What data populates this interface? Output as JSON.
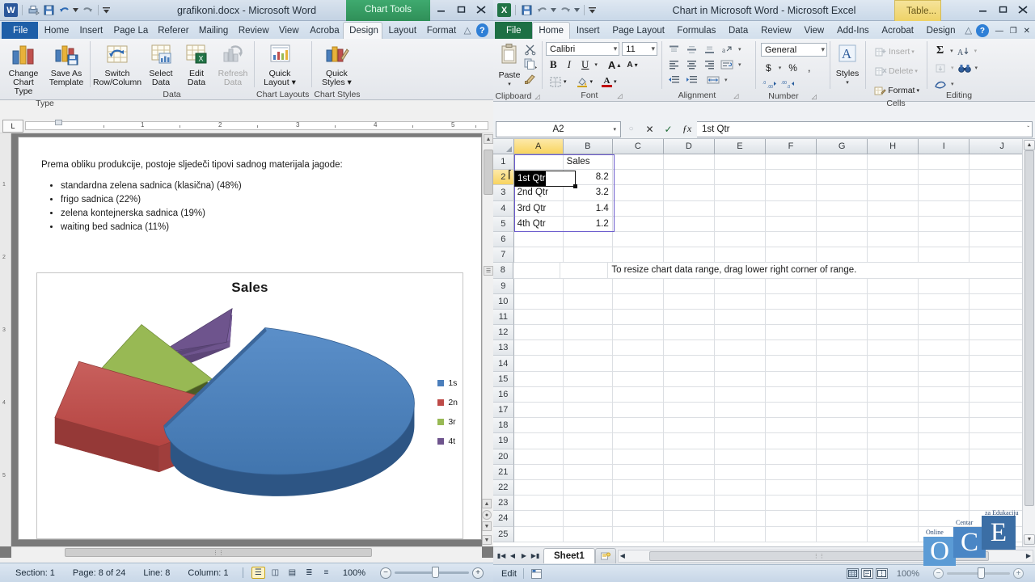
{
  "word": {
    "app_initial": "W",
    "title": "grafikoni.docx  -  Microsoft Word",
    "contextual_tab_label": "Chart Tools",
    "qat": [
      {
        "name": "print-preview-icon",
        "glyph": "⎙"
      },
      {
        "name": "save-icon",
        "glyph": "■"
      },
      {
        "name": "undo-icon",
        "glyph": "↶"
      },
      {
        "name": "undo-dropdown-icon",
        "glyph": "▾"
      },
      {
        "name": "redo-icon",
        "glyph": "↻"
      },
      {
        "name": "customize-qat-icon",
        "glyph": "☰"
      }
    ],
    "window_buttons": {
      "minimize": "—",
      "restore": "❐",
      "close": "✕"
    },
    "tabs": [
      {
        "label": "File",
        "kind": "file"
      },
      {
        "label": "Home"
      },
      {
        "label": "Insert"
      },
      {
        "label": "Page La"
      },
      {
        "label": "Referer"
      },
      {
        "label": "Mailing"
      },
      {
        "label": "Review"
      },
      {
        "label": "View"
      },
      {
        "label": "Acroba"
      },
      {
        "label": "Design",
        "active": true
      },
      {
        "label": "Layout"
      },
      {
        "label": "Format"
      }
    ],
    "tab_right_icons": [
      {
        "name": "minimize-ribbon-icon",
        "glyph": "△"
      },
      {
        "name": "help-icon",
        "glyph": "?"
      }
    ],
    "ribbon_groups": [
      {
        "label": "Type",
        "buttons": [
          {
            "name": "change-chart-type-button",
            "line1": "Change",
            "line2": "Chart Type",
            "icon": "bar-chart-icon"
          },
          {
            "name": "save-as-template-button",
            "line1": "Save As",
            "line2": "Template",
            "icon": "save-template-icon"
          }
        ]
      },
      {
        "label": "Data",
        "buttons": [
          {
            "name": "switch-row-column-button",
            "line1": "Switch",
            "line2": "Row/Column",
            "icon": "switch-rowcol-icon"
          },
          {
            "name": "select-data-button",
            "line1": "Select",
            "line2": "Data",
            "icon": "select-data-icon"
          },
          {
            "name": "edit-data-button",
            "line1": "Edit",
            "line2": "Data",
            "icon": "edit-data-icon"
          },
          {
            "name": "refresh-data-button",
            "line1": "Refresh",
            "line2": "Data",
            "icon": "refresh-data-icon",
            "disabled": true
          }
        ]
      },
      {
        "label": "Chart Layouts",
        "buttons": [
          {
            "name": "quick-layout-button",
            "line1": "Quick",
            "line2": "Layout ▾",
            "icon": "quick-layout-icon"
          }
        ]
      },
      {
        "label": "Chart Styles",
        "buttons": [
          {
            "name": "quick-styles-button",
            "line1": "Quick",
            "line2": "Styles ▾",
            "icon": "quick-styles-icon"
          }
        ]
      }
    ],
    "ruler": {
      "tick_numbers": [
        "1",
        "2",
        "3",
        "4",
        "5"
      ],
      "corner_glyph": "L"
    },
    "document": {
      "intro": "Prema obliku produkcije, postoje sljedeči tipovi sadnog materijala jagode:",
      "bullets": [
        "standardna zelena sadnica (klasična) (48%)",
        "frigo sadnica (22%)",
        "zelena kontejnerska sadnica  (19%)",
        "waiting bed sadnica  (11%)"
      ]
    },
    "status": {
      "section": "Section: 1",
      "page": "Page: 8 of 24",
      "line": "Line: 8",
      "column": "Column: 1",
      "zoom": "100%",
      "view_buttons": [
        {
          "name": "print-layout-view-button",
          "glyph": "☰",
          "active": true
        },
        {
          "name": "full-screen-reading-view-button",
          "glyph": "◫"
        },
        {
          "name": "web-layout-view-button",
          "glyph": "▤"
        },
        {
          "name": "outline-view-button",
          "glyph": "≣"
        },
        {
          "name": "draft-view-button",
          "glyph": "≡"
        }
      ],
      "zoom_out_glyph": "−",
      "zoom_in_glyph": "+"
    }
  },
  "excel": {
    "app_initial": "X",
    "title": "Chart in Microsoft Word  -  Microsoft Excel",
    "contextual_tab_label": "Table...",
    "qat": [
      {
        "name": "save-icon",
        "glyph": "■"
      },
      {
        "name": "undo-icon",
        "glyph": "↶"
      },
      {
        "name": "undo-dropdown-icon",
        "glyph": "▾"
      },
      {
        "name": "redo-icon",
        "glyph": "↷"
      },
      {
        "name": "redo-dropdown-icon",
        "glyph": "▾"
      },
      {
        "name": "customize-qat-icon",
        "glyph": "☰"
      }
    ],
    "window_buttons": {
      "minimize": "—",
      "restore": "❐",
      "close": "✕"
    },
    "tabs": [
      {
        "label": "File",
        "kind": "file"
      },
      {
        "label": "Home",
        "active": true
      },
      {
        "label": "Insert"
      },
      {
        "label": "Page Layout"
      },
      {
        "label": "Formulas"
      },
      {
        "label": "Data"
      },
      {
        "label": "Review"
      },
      {
        "label": "View"
      },
      {
        "label": "Add-Ins"
      },
      {
        "label": "Acrobat"
      },
      {
        "label": "Design"
      }
    ],
    "tab_right_icons": [
      {
        "name": "minimize-ribbon-icon",
        "glyph": "△"
      },
      {
        "name": "help-icon",
        "glyph": "?"
      },
      {
        "name": "ribbon-minimize-icon",
        "glyph": "—"
      },
      {
        "name": "ribbon-restore-icon",
        "glyph": "❐"
      },
      {
        "name": "ribbon-close-icon",
        "glyph": "✕"
      }
    ],
    "ribbon_groups": [
      {
        "label": "Clipboard",
        "items": [
          {
            "name": "paste-button",
            "label": "Paste",
            "icon": "clipboard-icon"
          },
          {
            "name": "cut-button",
            "label": "",
            "icon": "scissors-icon"
          },
          {
            "name": "copy-button",
            "label": "",
            "icon": "copy-icon"
          },
          {
            "name": "format-painter-button",
            "label": "",
            "icon": "paintbrush-icon"
          }
        ]
      },
      {
        "label": "Font",
        "font_name": "Calibri",
        "font_size": "11",
        "items": [
          {
            "name": "bold-button",
            "label": "B",
            "icon": "bold-icon"
          },
          {
            "name": "italic-button",
            "label": "I",
            "icon": "italic-icon"
          },
          {
            "name": "underline-button",
            "label": "U",
            "icon": "underline-icon"
          },
          {
            "name": "grow-font-button",
            "label": "A",
            "icon": "grow-font-icon"
          },
          {
            "name": "shrink-font-button",
            "label": "A",
            "icon": "shrink-font-icon"
          },
          {
            "name": "borders-button",
            "label": "",
            "icon": "borders-icon"
          },
          {
            "name": "fill-color-button",
            "label": "",
            "icon": "fill-color-icon"
          },
          {
            "name": "font-color-button",
            "label": "A",
            "icon": "font-color-icon"
          }
        ]
      },
      {
        "label": "Alignment",
        "items": [
          {
            "name": "align-top-button",
            "icon": "align-top-icon"
          },
          {
            "name": "align-middle-button",
            "icon": "align-middle-icon"
          },
          {
            "name": "align-bottom-button",
            "icon": "align-bottom-icon"
          },
          {
            "name": "orientation-button",
            "icon": "orientation-icon"
          },
          {
            "name": "align-left-button",
            "icon": "align-left-icon"
          },
          {
            "name": "align-center-button",
            "icon": "align-center-icon"
          },
          {
            "name": "align-right-button",
            "icon": "align-right-icon"
          },
          {
            "name": "wrap-text-button",
            "icon": "wrap-text-icon"
          },
          {
            "name": "decrease-indent-button",
            "icon": "decrease-indent-icon"
          },
          {
            "name": "increase-indent-button",
            "icon": "increase-indent-icon"
          },
          {
            "name": "merge-and-center-button",
            "icon": "merge-cells-icon"
          }
        ]
      },
      {
        "label": "Number",
        "format": "General",
        "items": [
          {
            "name": "accounting-format-button",
            "label": "$",
            "icon": "currency-icon"
          },
          {
            "name": "percent-style-button",
            "label": "%",
            "icon": "percent-icon"
          },
          {
            "name": "comma-style-button",
            "label": ",",
            "icon": "comma-icon"
          },
          {
            "name": "increase-decimal-button",
            "label": ".00",
            "icon": "increase-decimal-icon"
          },
          {
            "name": "decrease-decimal-button",
            "label": ".0",
            "icon": "decrease-decimal-icon"
          }
        ]
      },
      {
        "label": "Cells",
        "items": [
          {
            "name": "insert-cells-button",
            "label": "Insert",
            "icon": "insert-icon",
            "disabled": true
          },
          {
            "name": "delete-cells-button",
            "label": "Delete",
            "icon": "delete-icon",
            "disabled": true
          },
          {
            "name": "format-cells-button",
            "label": "Format",
            "icon": "format-icon"
          }
        ]
      },
      {
        "label": "Editing",
        "items": [
          {
            "name": "autosum-button",
            "label": "Σ",
            "icon": "sigma-icon"
          },
          {
            "name": "sort-and-filter-button",
            "label": "",
            "icon": "sort-filter-icon"
          },
          {
            "name": "fill-button",
            "label": "",
            "icon": "fill-down-icon",
            "disabled": true
          },
          {
            "name": "find-and-select-button",
            "label": "",
            "icon": "binoculars-icon"
          },
          {
            "name": "clear-button",
            "label": "",
            "icon": "eraser-icon"
          }
        ]
      }
    ],
    "styles_group": {
      "label": "Styles",
      "button_label": "Styles",
      "icon": "styles-icon"
    },
    "formula_bar": {
      "name_box": "A2",
      "formula": "1st Qtr",
      "cancel_glyph": "✕",
      "enter_glyph": "✓",
      "function_glyph": "ƒx",
      "insert_function_label": "fx",
      "dropdown_glyph": "▾",
      "expand_glyph": "ˇ"
    },
    "grid": {
      "columns": [
        "A",
        "B",
        "C",
        "D",
        "E",
        "F",
        "G",
        "H",
        "I",
        "J"
      ],
      "rows": [
        "1",
        "2",
        "3",
        "4",
        "5",
        "6",
        "7",
        "8",
        "9",
        "10",
        "11",
        "12",
        "13",
        "14",
        "15",
        "16",
        "17",
        "18",
        "19",
        "20",
        "21",
        "22",
        "23",
        "24",
        "25"
      ],
      "selected_cell": "A2",
      "editing_value": "1st Qtr",
      "cells": [
        {
          "row": 1,
          "col": "B",
          "value": "Sales",
          "align": "left"
        },
        {
          "row": 2,
          "col": "A",
          "value": "1st Qtr",
          "align": "left"
        },
        {
          "row": 2,
          "col": "B",
          "value": "8.2",
          "align": "right"
        },
        {
          "row": 3,
          "col": "A",
          "value": "2nd Qtr",
          "align": "left"
        },
        {
          "row": 3,
          "col": "B",
          "value": "3.2",
          "align": "right"
        },
        {
          "row": 4,
          "col": "A",
          "value": "3rd Qtr",
          "align": "left"
        },
        {
          "row": 4,
          "col": "B",
          "value": "1.4",
          "align": "right"
        },
        {
          "row": 5,
          "col": "A",
          "value": "4th Qtr",
          "align": "left"
        },
        {
          "row": 5,
          "col": "B",
          "value": "1.2",
          "align": "right"
        },
        {
          "row": 8,
          "col": "C",
          "value": "To resize chart data range, drag lower right corner of range.",
          "align": "left"
        }
      ]
    },
    "sheet_tabs": {
      "nav": [
        "⏮",
        "◀",
        "▶",
        "⏭"
      ],
      "tabs": [
        "Sheet1"
      ],
      "insert_sheet_label": "⬚"
    },
    "status": {
      "mode": "Edit",
      "zoom": "100%",
      "view_buttons": [
        {
          "name": "normal-view-button",
          "glyph": "▦",
          "active": true
        },
        {
          "name": "page-layout-view-button",
          "glyph": "▣"
        },
        {
          "name": "page-break-preview-button",
          "glyph": "▥"
        }
      ],
      "zoom_out_glyph": "−",
      "zoom_in_glyph": "+"
    }
  },
  "watermark": {
    "letters": [
      "O",
      "C",
      "E"
    ],
    "captions": [
      "Online",
      "Centar",
      "za Edukaciju"
    ]
  },
  "chart_data": {
    "type": "pie",
    "title": "Sales",
    "series_name": "Sales",
    "categories": [
      "1st Qtr",
      "2nd Qtr",
      "3rd Qtr",
      "4th Qtr"
    ],
    "values": [
      8.2,
      3.2,
      1.4,
      1.2
    ],
    "legend_labels_visible": [
      "1s",
      "2n",
      "3r",
      "4t"
    ],
    "colors": [
      "#4a7ebb",
      "#be4b48",
      "#98b954",
      "#6e548d"
    ],
    "legend_position": "right",
    "exploded": true,
    "three_d": true,
    "xlabel": "",
    "ylabel": ""
  }
}
